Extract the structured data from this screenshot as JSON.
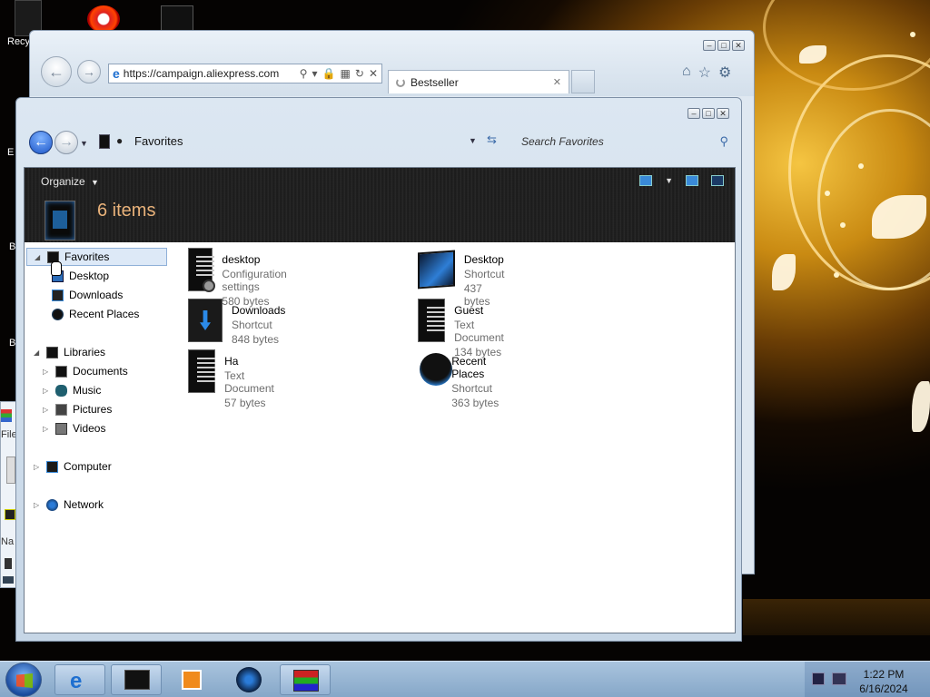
{
  "desktop": {
    "icons": [
      "Recy",
      "E",
      "B",
      "B"
    ]
  },
  "browser": {
    "url": "https://campaign.aliexpress.com",
    "tab_label": "Bestseller",
    "caption": {
      "min": "–",
      "max": "□",
      "close": "✕"
    }
  },
  "sidewin": {
    "labels": [
      "File",
      "Na"
    ]
  },
  "explorer": {
    "caption": {
      "min": "–",
      "max": "□",
      "close": "✕"
    },
    "breadcrumb": "Favorites",
    "search_placeholder": "Search Favorites",
    "organize_label": "Organize",
    "item_count": "6 items",
    "tree": {
      "favorites": "Favorites",
      "desktop": "Desktop",
      "downloads": "Downloads",
      "recent_places": "Recent Places",
      "libraries": "Libraries",
      "documents": "Documents",
      "music": "Music",
      "pictures": "Pictures",
      "videos": "Videos",
      "computer": "Computer",
      "network": "Network"
    },
    "files": [
      {
        "name": "desktop",
        "type": "Configuration settings",
        "size": "580 bytes"
      },
      {
        "name": "Desktop",
        "type": "Shortcut",
        "size": "437 bytes"
      },
      {
        "name": "Downloads",
        "type": "Shortcut",
        "size": "848 bytes"
      },
      {
        "name": "Guest",
        "type": "Text Document",
        "size": "134 bytes"
      },
      {
        "name": "Ha",
        "type": "Text Document",
        "size": "57 bytes"
      },
      {
        "name": "Recent Places",
        "type": "Shortcut",
        "size": "363 bytes"
      }
    ]
  },
  "taskbar": {
    "time": "1:22 PM",
    "date": "6/16/2024"
  },
  "colors": {
    "accent": "#1c55c8",
    "item_count": "#e9b27a",
    "taskbar": "#9bb8d6"
  }
}
